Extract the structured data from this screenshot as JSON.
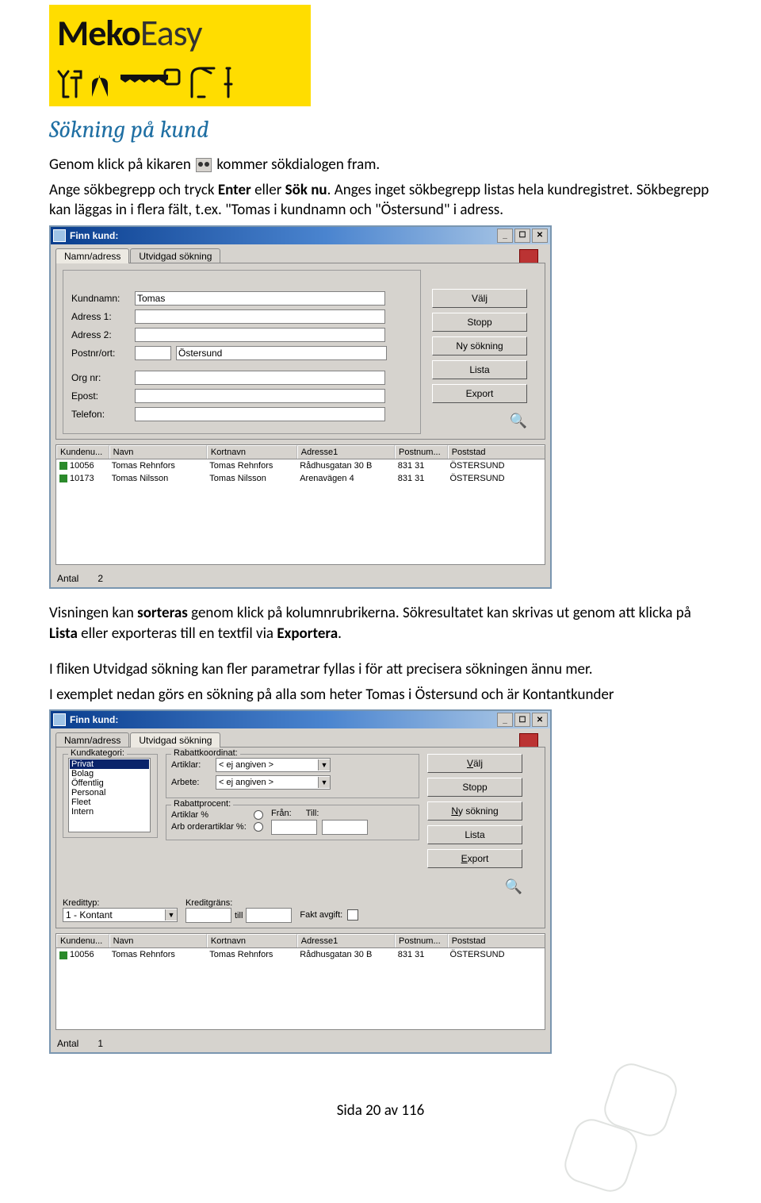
{
  "logo": {
    "bold": "Meko",
    "light": "Easy"
  },
  "section_title": "Sökning på kund",
  "intro_p1_a": "Genom klick på kikaren ",
  "intro_p1_b": " kommer sökdialogen fram.",
  "intro_p2_a": "Ange sökbegrepp och tryck ",
  "intro_p2_enter": "Enter",
  "intro_p2_b": " eller ",
  "intro_p2_sok": "Sök nu",
  "intro_p2_c": ". Anges inget sökbegrepp listas hela kundregistret. Sökbegrepp kan läggas in i flera fält, t.ex. \"Tomas i kundnamn och \"Östersund\" i adress.",
  "window1": {
    "title": "Finn kund:",
    "tabs": {
      "active": "Namn/adress",
      "inactive": "Utvidgad sökning"
    },
    "labels": {
      "kundnamn": "Kundnamn:",
      "adress1": "Adress 1:",
      "adress2": "Adress 2:",
      "postnr": "Postnr/ort:",
      "orgnr": "Org nr:",
      "epost": "Epost:",
      "telefon": "Telefon:"
    },
    "values": {
      "kundnamn": "Tomas",
      "postort": "Östersund"
    },
    "buttons": {
      "valj": "Välj",
      "stopp": "Stopp",
      "ny": "Ny sökning",
      "lista": "Lista",
      "export": "Export"
    },
    "headers": {
      "id": "Kundenu...",
      "navn": "Navn",
      "kort": "Kortnavn",
      "adr": "Adresse1",
      "post": "Postnum...",
      "stad": "Poststad"
    },
    "rows": [
      {
        "id": "10056",
        "navn": "Tomas Rehnfors",
        "kort": "Tomas Rehnfors",
        "adr": "Rådhusgatan 30 B",
        "post": "831 31",
        "stad": "ÖSTERSUND"
      },
      {
        "id": "10173",
        "navn": "Tomas Nilsson",
        "kort": "Tomas Nilsson",
        "adr": "Arenavägen 4",
        "post": "831 31",
        "stad": "ÖSTERSUND"
      }
    ],
    "footer": {
      "antal_label": "Antal",
      "antal_value": "2"
    }
  },
  "mid_p1_a": "Visningen kan ",
  "mid_p1_sorteras": "sorteras",
  "mid_p1_b": " genom klick på kolumnrubrikerna. Sökresultatet kan skrivas ut genom att klicka på ",
  "mid_p1_lista": "Lista",
  "mid_p1_c": " eller exporteras till en textfil via ",
  "mid_p1_exp": "Exportera",
  "mid_p1_d": ".",
  "mid_p2": "I fliken Utvidgad sökning kan fler parametrar fyllas i för att precisera sökningen ännu mer.",
  "mid_p3": "I exemplet nedan görs en sökning på alla som heter Tomas i Östersund och är Kontantkunder",
  "window2": {
    "title": "Finn kund:",
    "tabs": {
      "inactive": "Namn/adress",
      "active": "Utvidgad sökning"
    },
    "kundkategori": {
      "legend": "Kundkategori:",
      "items": [
        "Privat",
        "Bolag",
        "Öffentlig",
        "Personal",
        "Fleet",
        "Intern"
      ]
    },
    "rabattkoord": {
      "legend": "Rabattkoordinat:",
      "artiklar_label": "Artiklar:",
      "arbete_label": "Arbete:",
      "ej_angiven": "< ej angiven >"
    },
    "rabattprocent": {
      "legend": "Rabattprocent:",
      "artiklar": "Artiklar %",
      "arborder": "Arb orderartiklar %:",
      "fran": "Från:",
      "till": "Till:"
    },
    "kredittyp_label": "Kredittyp:",
    "kredittyp_value": "1 - Kontant",
    "kreditgrans_label": "Kreditgräns:",
    "kreditgrans_till": "till",
    "faktavgift": "Fakt avgift:",
    "buttons": {
      "valj": "Välj",
      "stopp": "Stopp",
      "ny": "Ny sökning",
      "lista": "Lista",
      "export": "Export"
    },
    "rows": [
      {
        "id": "10056",
        "navn": "Tomas Rehnfors",
        "kort": "Tomas Rehnfors",
        "adr": "Rådhusgatan 30 B",
        "post": "831 31",
        "stad": "ÖSTERSUND"
      }
    ],
    "footer": {
      "antal_label": "Antal",
      "antal_value": "1"
    }
  },
  "page_footer": "Sida 20 av 116"
}
